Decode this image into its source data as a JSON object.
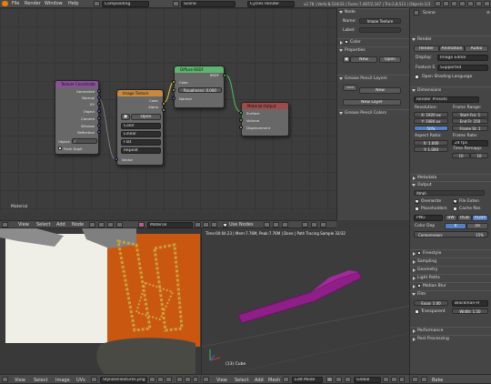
{
  "topbar": {
    "menus": [
      "File",
      "Render",
      "Window",
      "Help"
    ],
    "screen": "Compositing",
    "scene": "Scene",
    "engine": "Cycles Render",
    "info": "v2.78 | Verts:8,534/33 | Faces:7,487/2,167 | Tris:2,8,513 | Objects:1/3 | Lamps:0/1"
  },
  "node_editor": {
    "label": "Material",
    "header": {
      "menus": [
        "View",
        "Select",
        "Add",
        "Node"
      ],
      "material": "Material",
      "use_nodes": "Use Nodes"
    },
    "tex_coord": {
      "title": "Texture Coordinate",
      "outputs": [
        "Generated",
        "Normal",
        "UV",
        "Object",
        "Camera",
        "Window",
        "Reflection"
      ],
      "object_label": "Object:",
      "from_dupli": "From Dupli"
    },
    "image_tex": {
      "title": "Image Texture",
      "out_color": "Color",
      "out_alpha": "Alpha",
      "open": "Open",
      "opts": [
        "Color",
        "Linear",
        "Flat",
        "Repeat"
      ],
      "vector": "Vector"
    },
    "diffuse": {
      "title": "Diffuse BSDF",
      "out": "BSDF",
      "color": "Color",
      "roughness": "Roughness: 0.000",
      "normal": "Normal"
    },
    "output": {
      "title": "Material Output",
      "inputs": [
        "Surface",
        "Volume",
        "Displacement"
      ]
    }
  },
  "side_panel": {
    "node_title": "Node",
    "name_label": "Name:",
    "name_value": "Image Texture",
    "label_label": "Label:",
    "label_value": "",
    "color": "Color",
    "properties": "Properties",
    "new": "New",
    "open": "Open",
    "grease_layers": "Grease Pencil Layers",
    "new2": "New",
    "new_layer": "New Layer",
    "grease_colors": "Grease Pencil Colors"
  },
  "properties": {
    "scene": "Scene",
    "render": "Render",
    "tabs": [
      "Render",
      "Animation",
      "Audio"
    ],
    "display_label": "Display:",
    "display_value": "Image Editor",
    "feature_label": "Feature S",
    "feature_value": "Supported",
    "osl": "Open Shading Language",
    "dimensions": "Dimensions",
    "presets": "Render Presets",
    "resolution": "Resolution:",
    "frame_range": "Frame Range:",
    "res_x": "X: 1920 px",
    "res_y": "Y: 1080 px",
    "res_pct": "50%",
    "start": "Start Fra: 1",
    "end": "End Fr: 250",
    "step": "Frame St: 1",
    "aspect": "Aspect Ratio:",
    "frame_rate": "Frame Rate:",
    "ax": "X: 1.000",
    "ay": "Y: 1.000",
    "fps": "24 fps",
    "time_remap": "Time Remapp:",
    "tr_old": "10",
    "tr_new": "10",
    "metadata": "Metadata",
    "output": "Output",
    "path": "/tmp\\",
    "overwrite": "Overwrite",
    "file_ext": "File Exten",
    "placeholders": "Placeholders",
    "cache": "Cache Res",
    "format": "PNG",
    "bw": "BW",
    "rgb": "RGB",
    "rgba": "RGBA",
    "color_depth": "Color Dep",
    "cd8": "8",
    "cd16": "16",
    "compression": "Compression:",
    "comp_val": "15%",
    "sections": [
      "Freestyle",
      "Sampling",
      "Geometry",
      "Light Paths",
      "Motion Blur",
      "Film"
    ],
    "exposure": "Expo: 1.00",
    "filter": "Blackman-H",
    "transparent": "Transparent",
    "width": "Width: 1.50",
    "tail": [
      "Performance",
      "Post Processing"
    ],
    "bottom_labels": [
      "Bake"
    ]
  },
  "image_editor": {
    "header": {
      "menus": [
        "View",
        "Select",
        "Image",
        "UVs"
      ],
      "image": "StylizedTextures.png",
      "view": "View"
    }
  },
  "viewport": {
    "info": "Time:00:04.23 | Mem:7.76M, Peak:7.76M | Done | Path Tracing Sample 32/32",
    "object": "(13) Cube",
    "header": {
      "menus": [
        "View",
        "Select",
        "Add",
        "Mesh"
      ],
      "mode": "Edit Mode",
      "orientation": "Global"
    }
  },
  "colors": {
    "node_bg": "#3d3d3d",
    "orange": "#c9570f",
    "purple": "#8d1f86",
    "accent": "#5680c2"
  }
}
